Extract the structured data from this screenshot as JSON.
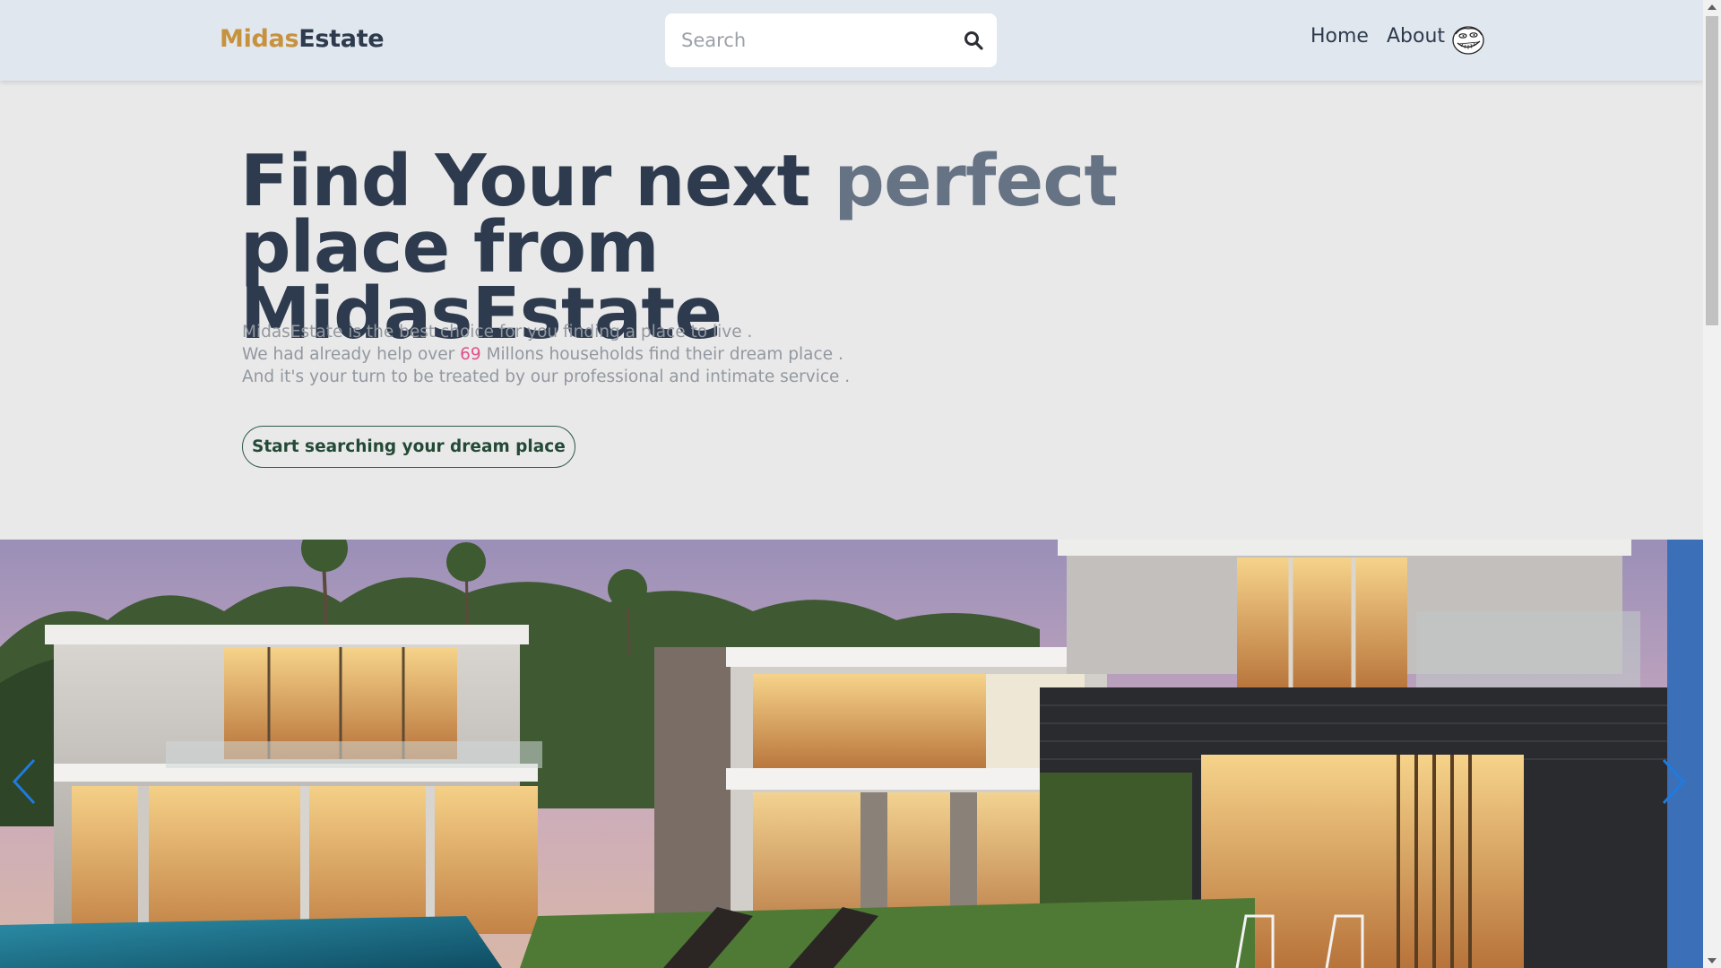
{
  "navbar": {
    "brand_part1": "Midas",
    "brand_part2": "Estate",
    "search_placeholder": "Search",
    "links": [
      "Home",
      "About"
    ]
  },
  "hero": {
    "title_part1": "Find Your next ",
    "title_accent": "perfect",
    "title_line2": "place from MidasEstate",
    "desc_line1": "MidasEstate is the best choice for you finding a place to live .",
    "desc_line2_pre": "We had already help over ",
    "desc_line2_num": "69",
    "desc_line2_post": " Millons households find their dream place .",
    "desc_line3": "And it's your turn to be treated by our professional and intimate service .",
    "cta_label": "Start searching your dream place"
  },
  "carousel": {
    "image_subject": "modern luxury house with pool at dusk"
  },
  "colors": {
    "brand_gold": "#c7923e",
    "brand_dark": "#2e3b4e",
    "accent_gray": "#667385",
    "highlight_pink": "#e0528a",
    "cta_green": "#2f5a43",
    "nav_bg": "#e1e7ee",
    "page_bg": "#e9e9e9",
    "carousel_arrow": "#1e7be0"
  },
  "icons": {
    "search": "search-icon",
    "avatar": "troll-face-avatar",
    "prev": "chevron-left-icon",
    "next": "chevron-right-icon"
  }
}
